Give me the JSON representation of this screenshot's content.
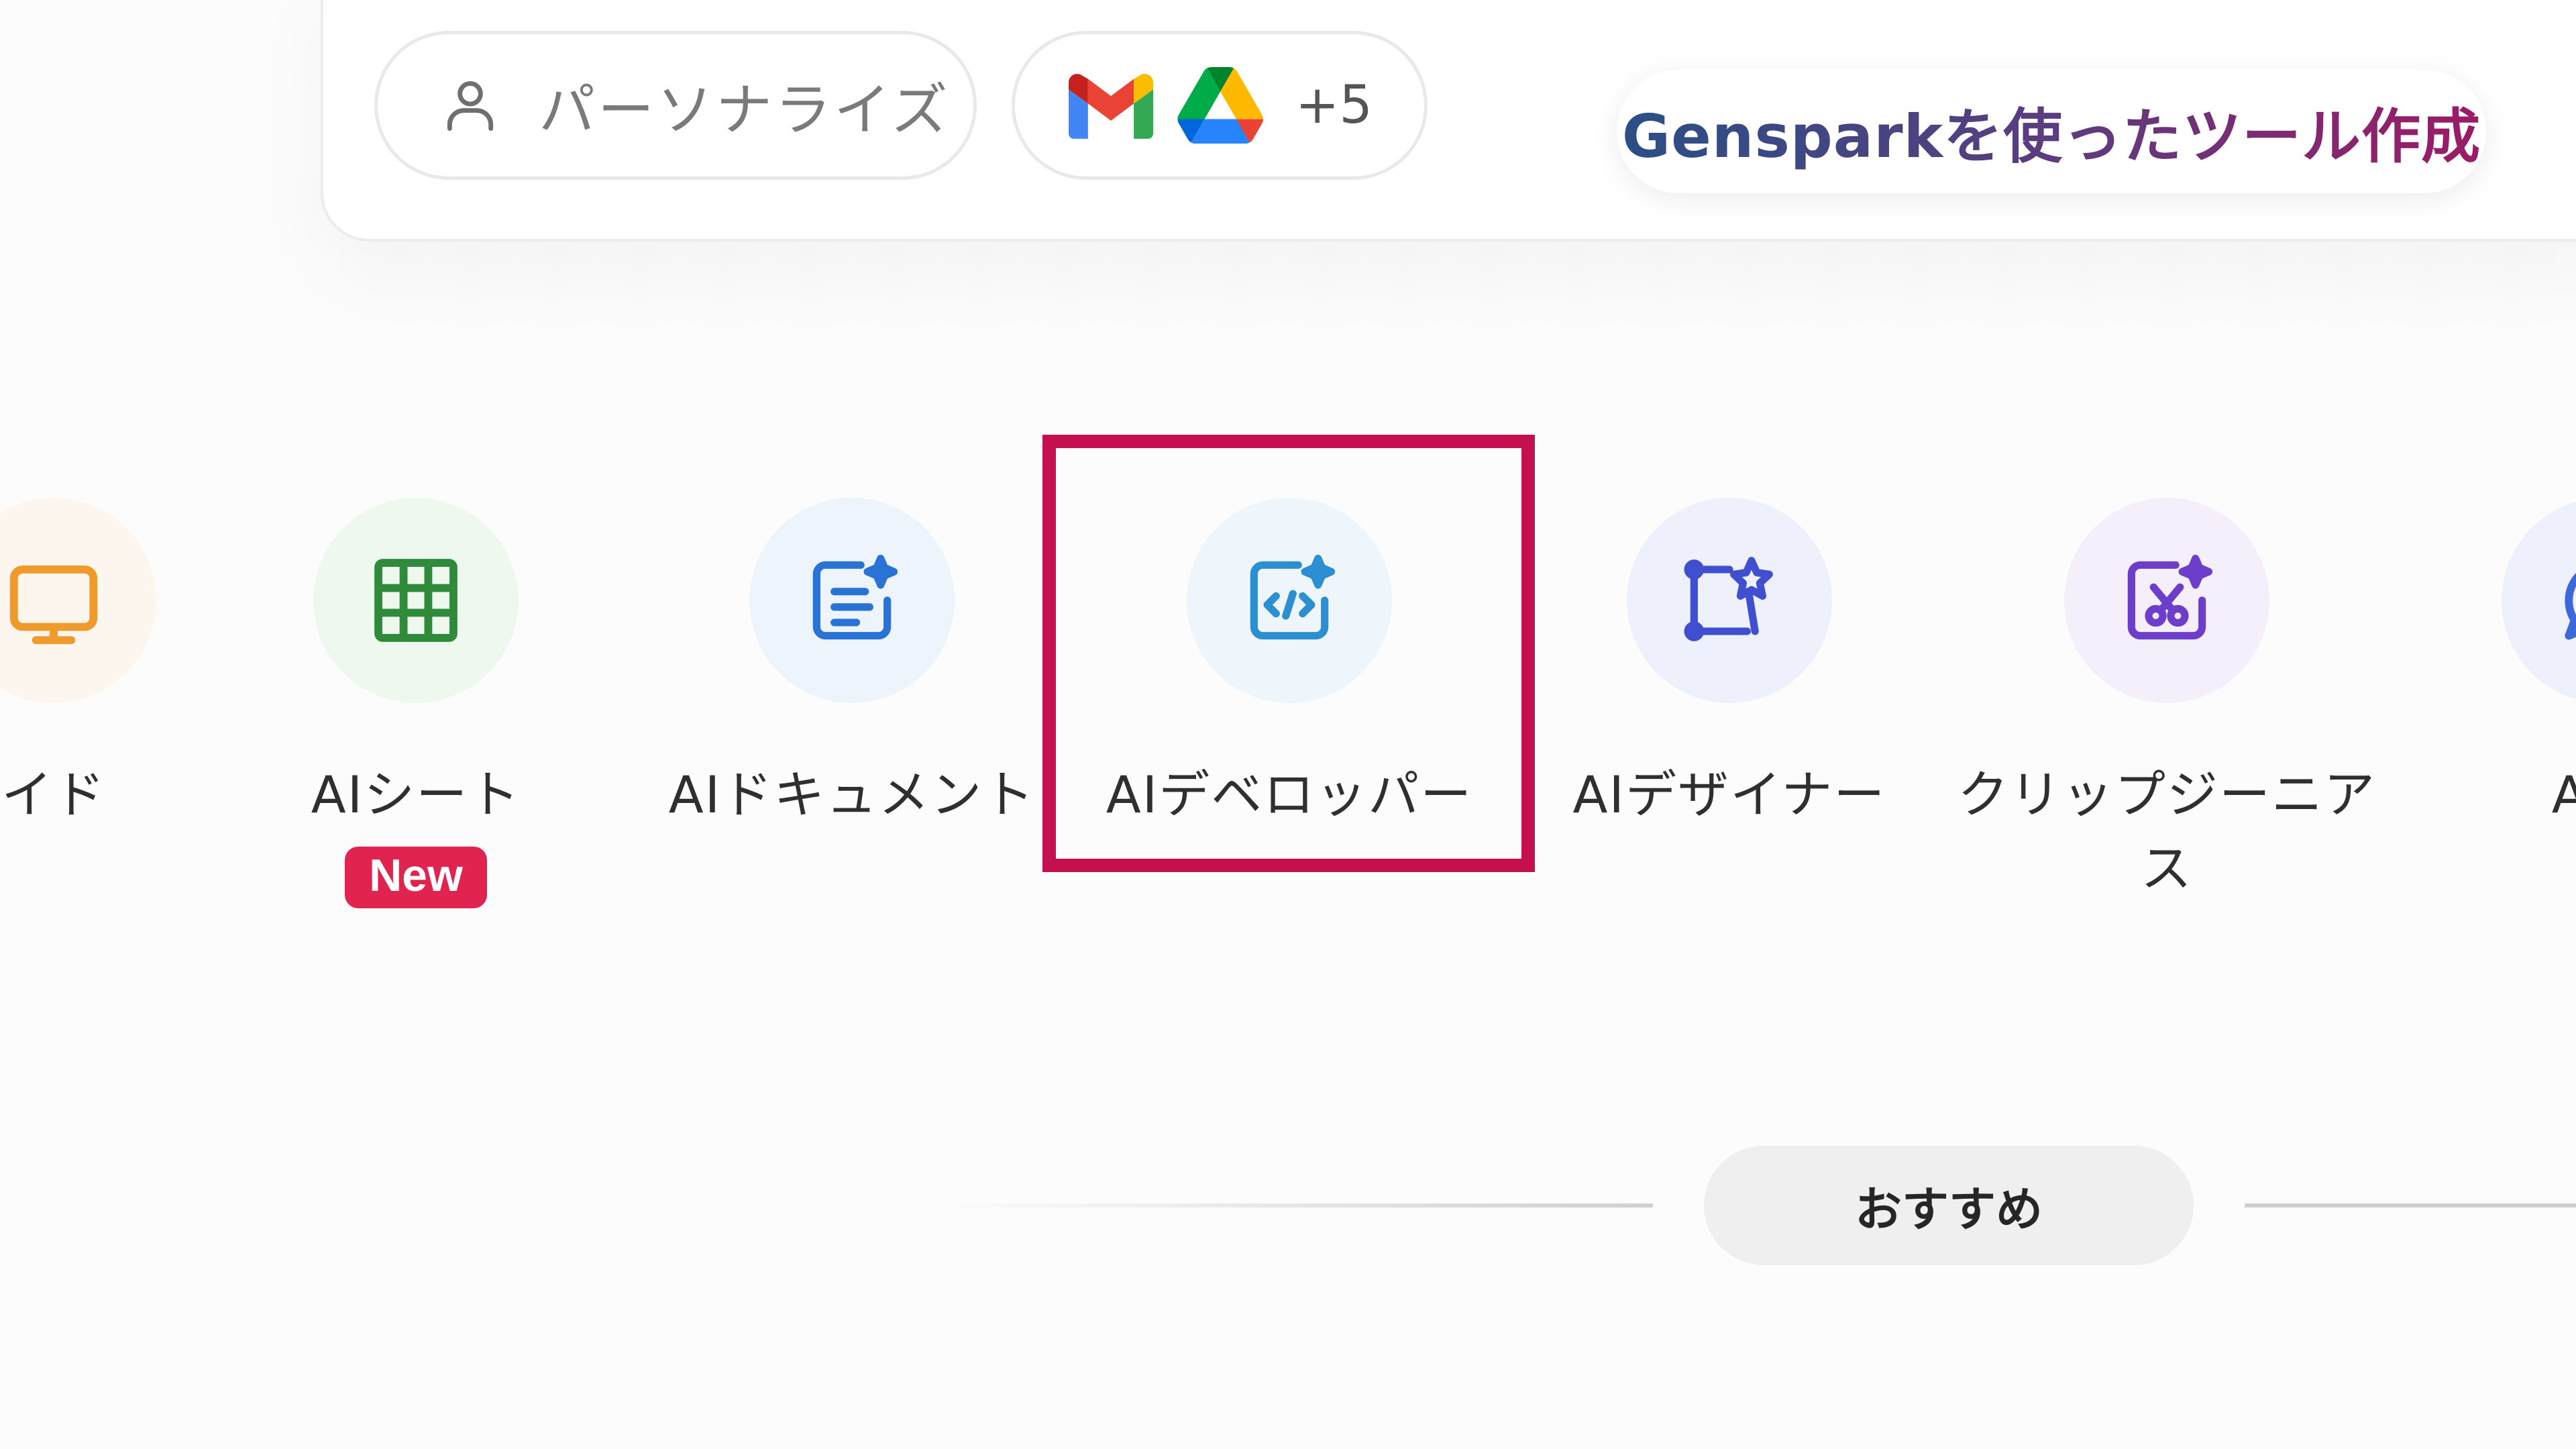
{
  "input_bar": {
    "personalize_label": "パーソナライズ",
    "integrations_extra_count": "+5",
    "tool_banner": "Gensparkを使ったツール作成"
  },
  "agents": [
    {
      "label": "イド",
      "icon": "slides-icon",
      "bg": "#fdf6ee",
      "color": "#f09a2b"
    },
    {
      "label": "AIシート",
      "badge": "New",
      "icon": "sheet-grid-icon",
      "bg": "#eef8ef",
      "color": "#2f8a3a"
    },
    {
      "label": "AIドキュメント",
      "icon": "document-sparkle-icon",
      "bg": "#eef4fb",
      "color": "#2a73d6"
    },
    {
      "label": "AIデベロッパー",
      "icon": "code-sparkle-icon",
      "bg": "#eef6fb",
      "color": "#2c8fd1",
      "highlighted": true
    },
    {
      "label": "AIデザイナー",
      "icon": "design-wand-icon",
      "bg": "#eef0fb",
      "color": "#3f4fd0"
    },
    {
      "label": "クリップジーニアス",
      "icon": "clip-scissors-icon",
      "bg": "#f4effb",
      "color": "#6d3ec9"
    },
    {
      "label": "AIチ",
      "icon": "chat-icon",
      "bg": "#eef1fb",
      "color": "#3d68d8"
    }
  ],
  "section": {
    "recommend_label": "おすすめ"
  },
  "colors": {
    "highlight": "#c4104e",
    "new_badge": "#e0244f"
  }
}
